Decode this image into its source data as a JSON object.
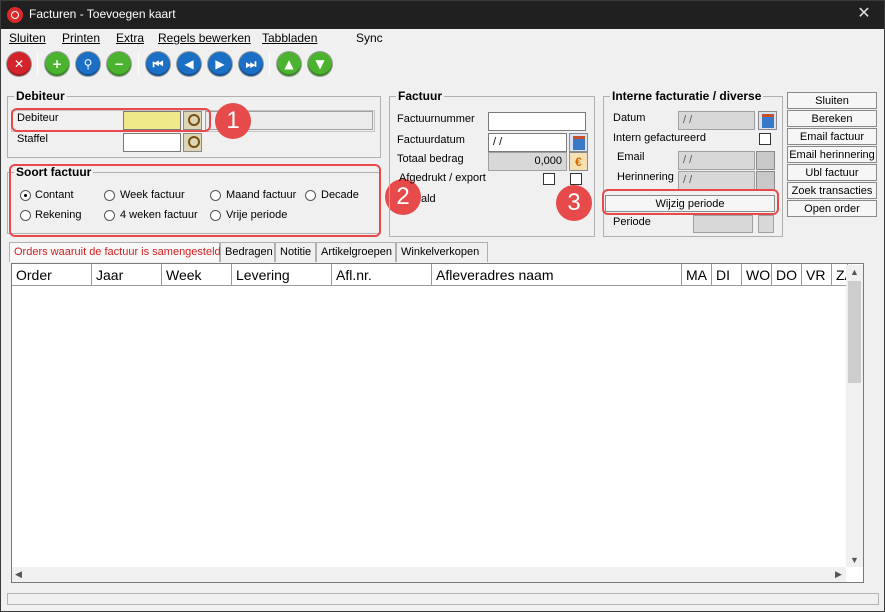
{
  "window": {
    "title": "Facturen - Toevoegen kaart",
    "close_glyph": "✕"
  },
  "menu": [
    "Sluiten",
    "Printen",
    "Extra",
    "Regels bewerken",
    "Tabbladen",
    "Sync"
  ],
  "toolbar_icons": [
    "close-icon",
    "add-icon",
    "search-icon",
    "remove-icon",
    "first-icon",
    "previous-icon",
    "next-icon",
    "last-icon",
    "up-icon",
    "down-icon"
  ],
  "debiteur": {
    "title": "Debiteur",
    "debiteur_label": "Debiteur",
    "debiteur_value": "",
    "staffel_label": "Staffel",
    "staffel_value": ""
  },
  "soort_factuur": {
    "title": "Soort factuur",
    "options": [
      "Contant",
      "Week factuur",
      "Maand factuur",
      "Decade",
      "Rekening",
      "4 weken factuur",
      "Vrije periode"
    ],
    "selected": "Contant"
  },
  "factuur": {
    "title": "Factuur",
    "factuurnummer_label": "Factuurnummer",
    "factuurnummer_value": "",
    "factuurdatum_label": "Factuurdatum",
    "factuurdatum_value": " / /",
    "totaal_label": "Totaal bedrag",
    "totaal_value": "0,000",
    "afgedrukt_label": "Afgedrukt / export",
    "betaald_label": "ald"
  },
  "intern": {
    "title": "Interne facturatie / diverse",
    "datum_label": "Datum",
    "datum_value": " / /",
    "intern_label": "Intern gefactureerd",
    "email_label": "Email",
    "email_value": " / /",
    "herinnering_label": "Herinnering",
    "herinnering_value": " / /",
    "wijzig_button": "Wijzig periode",
    "periode_label": "Periode"
  },
  "side_buttons": [
    "Sluiten",
    "Bereken",
    "Email factuur",
    "Email herinnering",
    "Ubl factuur",
    "Zoek transacties",
    "Open order"
  ],
  "tabs": [
    "Orders waaruit de factuur is samengesteld",
    "Bedragen",
    "Notitie",
    "Artikelgroepen",
    "Winkelverkopen"
  ],
  "grid_columns": [
    "Order",
    "Jaar",
    "Week",
    "Levering",
    "Afl.nr.",
    "Afleveradres naam",
    "MA",
    "DI",
    "WO",
    "DO",
    "VR",
    "ZA"
  ],
  "badges": [
    "1",
    "2",
    "3"
  ],
  "colors": {
    "highlight": "#e64a4a",
    "active_tab": "#d31f1f",
    "input_yellow": "#efe98a"
  }
}
